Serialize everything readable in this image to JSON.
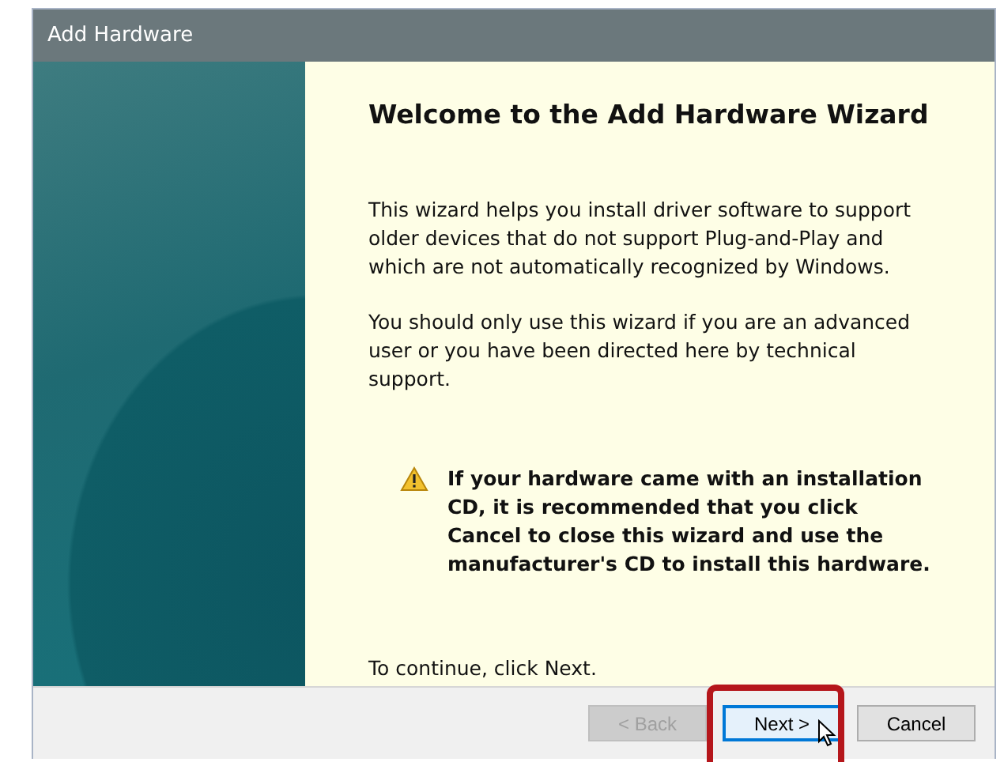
{
  "window": {
    "title": "Add Hardware"
  },
  "page": {
    "heading": "Welcome to the Add Hardware Wizard",
    "paragraphs": [
      "This wizard helps you install driver software to support older devices that do not support Plug-and-Play and which are not automatically recognized by Windows.",
      "You should only use this wizard if you are an advanced user or you have been directed here by technical support."
    ],
    "warning": "If your hardware came with an installation CD, it is recommended that you click Cancel to close this wizard and use the manufacturer's CD to install this hardware.",
    "footer": "To continue, click Next."
  },
  "buttons": [
    {
      "label": "< Back",
      "disabled": true,
      "focused": false,
      "highlighted": false
    },
    {
      "label": "Next >",
      "disabled": false,
      "focused": true,
      "highlighted": true
    },
    {
      "label": "Cancel",
      "disabled": false,
      "focused": false,
      "highlighted": false
    }
  ]
}
